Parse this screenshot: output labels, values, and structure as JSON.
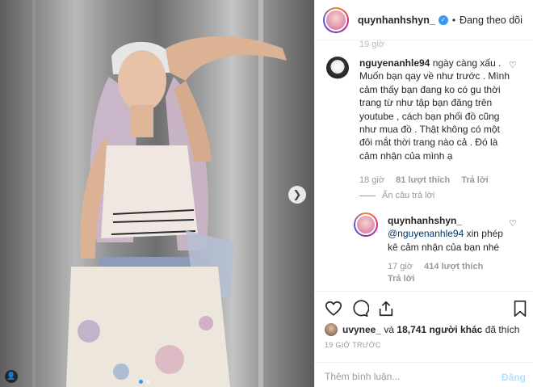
{
  "header": {
    "username": "quynhanhshyn_",
    "separator": "•",
    "follow_status": "Đang theo dõi"
  },
  "comments": {
    "top_time": "19 giờ",
    "items": [
      {
        "username": "nguyenanhle94",
        "text": "ngày càng xấu . Muốn bạn qay về như trước . Mình cảm thấy bạn đang ko có gu thời trang từ như tập bạn đăng trên youtube , cách bạn phối đồ cũng như mua đồ . Thật không có một đôi mắt thời trang nào cả . Đó là cảm nhận của mình ạ",
        "time": "18 giờ",
        "likes": "81 lượt thích",
        "reply": "Trả lời"
      }
    ],
    "hide_replies": "Ẩn câu trả lời",
    "reply": {
      "username": "quynhanhshyn_",
      "mention": "@nguyenanhle94",
      "text": "xin phép kê cảm nhận của bạn nhé",
      "time": "17 giờ",
      "likes": "414 lượt thích",
      "reply": "Trả lời"
    }
  },
  "likes": {
    "user": "uvynee_",
    "connector": "và",
    "count": "18,741 người khác",
    "suffix": "đã thích"
  },
  "post_time": "19 GIỜ TRƯỚC",
  "add_comment": {
    "placeholder": "Thêm bình luận...",
    "post_label": "Đăng"
  },
  "icons": {
    "verified": "verified-badge-icon",
    "heart": "heart-icon",
    "comment": "comment-icon",
    "share": "share-icon",
    "save": "bookmark-icon",
    "next": "chevron-right-icon"
  },
  "colors": {
    "link_blue": "#3897f0",
    "post_button_disabled": "#b2dffc",
    "muted_text": "#999999"
  }
}
